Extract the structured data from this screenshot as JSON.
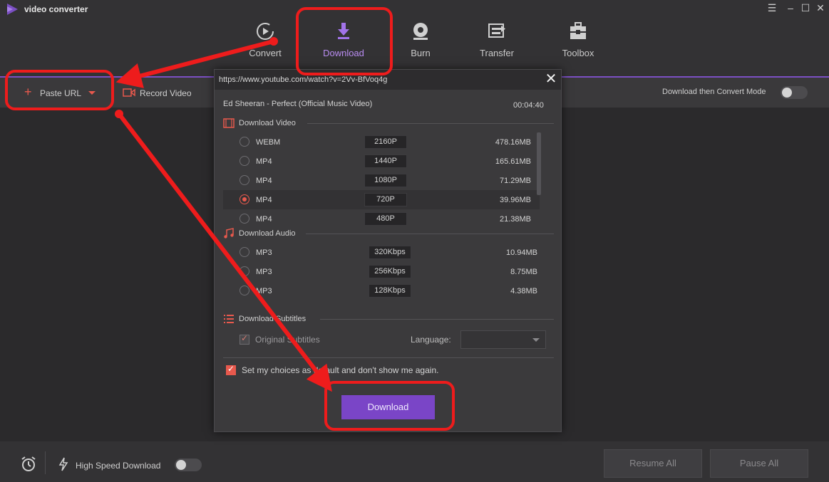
{
  "app": {
    "title": "video converter"
  },
  "nav": {
    "items": [
      {
        "label": "Convert",
        "icon": "convert-icon"
      },
      {
        "label": "Download",
        "icon": "download-icon",
        "active": true
      },
      {
        "label": "Burn",
        "icon": "burn-icon"
      },
      {
        "label": "Transfer",
        "icon": "transfer-icon"
      },
      {
        "label": "Toolbox",
        "icon": "toolbox-icon"
      }
    ]
  },
  "toolbar": {
    "paste_url": "Paste URL",
    "record_video": "Record Video",
    "download_then_convert": "Download then Convert Mode"
  },
  "modal": {
    "url": "https://www.youtube.com/watch?v=2Vv-BfVoq4g",
    "video_title": "Ed Sheeran - Perfect (Official Music Video)",
    "duration": "00:04:40",
    "video_section": "Download Video",
    "video_options": [
      {
        "format": "WEBM",
        "resolution": "2160P",
        "size": "478.16MB",
        "selected": false
      },
      {
        "format": "MP4",
        "resolution": "1440P",
        "size": "165.61MB",
        "selected": false
      },
      {
        "format": "MP4",
        "resolution": "1080P",
        "size": "71.29MB",
        "selected": false
      },
      {
        "format": "MP4",
        "resolution": "720P",
        "size": "39.96MB",
        "selected": true
      },
      {
        "format": "MP4",
        "resolution": "480P",
        "size": "21.38MB",
        "selected": false
      }
    ],
    "audio_section": "Download Audio",
    "audio_options": [
      {
        "format": "MP3",
        "bitrate": "320Kbps",
        "size": "10.94MB"
      },
      {
        "format": "MP3",
        "bitrate": "256Kbps",
        "size": "8.75MB"
      },
      {
        "format": "MP3",
        "bitrate": "128Kbps",
        "size": "4.38MB"
      }
    ],
    "subtitles_section": "Download Subtitles",
    "original_subtitles": "Original Subtitles",
    "language_label": "Language:",
    "language_value": "",
    "set_default": "Set my choices as default and don't show me again.",
    "download_button": "Download"
  },
  "bottom": {
    "high_speed_download": "High Speed Download",
    "resume_all": "Resume All",
    "pause_all": "Pause All"
  },
  "colors": {
    "accent": "#7a45c7",
    "brand_red": "#e8594d",
    "annotation": "#ee1c1c"
  }
}
